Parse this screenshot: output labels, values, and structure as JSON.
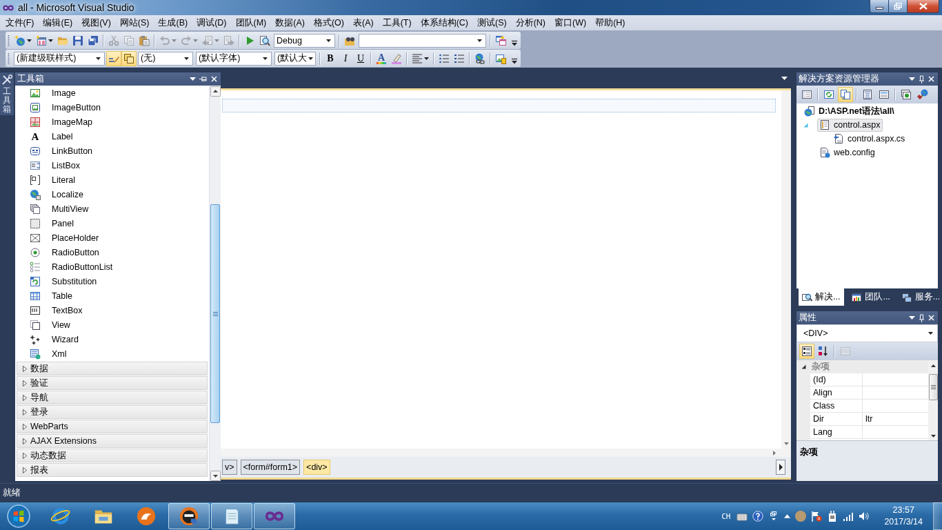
{
  "window": {
    "title": "all - Microsoft Visual Studio"
  },
  "menu": [
    "文件(F)",
    "编辑(E)",
    "视图(V)",
    "网站(S)",
    "生成(B)",
    "调试(D)",
    "团队(M)",
    "数据(A)",
    "格式(O)",
    "表(A)",
    "工具(T)",
    "体系结构(C)",
    "测试(S)",
    "分析(N)",
    "窗口(W)",
    "帮助(H)"
  ],
  "standard_toolbar": [
    {
      "kind": "split",
      "disabled": false
    },
    {
      "kind": "split",
      "disabled": false
    },
    {
      "kind": "button",
      "disabled": false
    },
    {
      "kind": "button",
      "disabled": false
    },
    {
      "kind": "button",
      "disabled": false
    },
    {
      "kind": "separator"
    },
    {
      "kind": "button",
      "disabled": true
    },
    {
      "kind": "button",
      "disabled": true
    },
    {
      "kind": "button",
      "disabled": false
    },
    {
      "kind": "separator"
    },
    {
      "kind": "split",
      "disabled": true
    },
    {
      "kind": "split",
      "disabled": true
    },
    {
      "kind": "split",
      "disabled": true
    },
    {
      "kind": "button",
      "disabled": true
    },
    {
      "kind": "separator"
    },
    {
      "kind": "button",
      "disabled": false
    },
    {
      "kind": "button",
      "disabled": false
    },
    {
      "kind": "combo",
      "value": "Debug"
    },
    {
      "kind": "separator"
    },
    {
      "kind": "button",
      "disabled": false
    },
    {
      "kind": "combo"
    },
    {
      "kind": "separator"
    },
    {
      "kind": "button",
      "disabled": false
    },
    {
      "kind": "overflow"
    }
  ],
  "formatting_toolbar": [
    {
      "kind": "combo",
      "value": "(新建级联样式)"
    },
    {
      "kind": "button",
      "pressed": true
    },
    {
      "kind": "button",
      "pressed": true
    },
    {
      "kind": "combo",
      "value": "(无)"
    },
    {
      "kind": "combo",
      "value": "(默认字体)"
    },
    {
      "kind": "combo",
      "value": "(默认大"
    },
    {
      "kind": "separator"
    },
    {
      "kind": "glyph",
      "text": "B",
      "pressed": false
    },
    {
      "kind": "glyph",
      "text": "I",
      "pressed": false
    },
    {
      "kind": "glyph",
      "text": "U",
      "pressed": false
    },
    {
      "kind": "separator"
    },
    {
      "kind": "font-color",
      "text": "A",
      "pressed": false
    },
    {
      "kind": "button",
      "pressed": false
    },
    {
      "kind": "separator"
    },
    {
      "kind": "split",
      "pressed": false
    },
    {
      "kind": "separator"
    },
    {
      "kind": "button",
      "pressed": false
    },
    {
      "kind": "button",
      "pressed": false
    },
    {
      "kind": "separator"
    },
    {
      "kind": "button",
      "pressed": false
    },
    {
      "kind": "separator"
    },
    {
      "kind": "button",
      "pressed": false
    },
    {
      "kind": "overflow"
    }
  ],
  "toolbox": {
    "side_tab": "工具箱",
    "title": "工具箱",
    "items": [
      {
        "label": "Image"
      },
      {
        "label": "ImageButton"
      },
      {
        "label": "ImageMap"
      },
      {
        "label": "Label",
        "glyph": "A"
      },
      {
        "label": "LinkButton"
      },
      {
        "label": "ListBox"
      },
      {
        "label": "Literal"
      },
      {
        "label": "Localize"
      },
      {
        "label": "MultiView"
      },
      {
        "label": "Panel"
      },
      {
        "label": "PlaceHolder"
      },
      {
        "label": "RadioButton"
      },
      {
        "label": "RadioButtonList"
      },
      {
        "label": "Substitution"
      },
      {
        "label": "Table"
      },
      {
        "label": "TextBox"
      },
      {
        "label": "View"
      },
      {
        "label": "Wizard"
      },
      {
        "label": "Xml"
      }
    ],
    "categories": [
      {
        "label": "数据",
        "expanded": false
      },
      {
        "label": "验证",
        "expanded": false
      },
      {
        "label": "导航",
        "expanded": false
      },
      {
        "label": "登录",
        "expanded": false
      },
      {
        "label": "WebParts",
        "expanded": false
      },
      {
        "label": "AJAX Extensions",
        "expanded": false
      },
      {
        "label": "动态数据",
        "expanded": false
      },
      {
        "label": "报表",
        "expanded": false
      }
    ]
  },
  "editor": {
    "tags": [
      {
        "label": "v>",
        "selected": false
      },
      {
        "label": "<form#form1>",
        "selected": false
      },
      {
        "label": "<div>",
        "selected": true
      }
    ]
  },
  "solution_explorer": {
    "title": "解决方案资源管理器",
    "toolbar": [
      {
        "kind": "button",
        "pressed": false
      },
      {
        "kind": "separator"
      },
      {
        "kind": "button",
        "pressed": false
      },
      {
        "kind": "button",
        "pressed": true
      },
      {
        "kind": "separator"
      },
      {
        "kind": "button",
        "pressed": false
      },
      {
        "kind": "button",
        "pressed": false
      },
      {
        "kind": "separator"
      },
      {
        "kind": "button",
        "pressed": false
      },
      {
        "kind": "button",
        "pressed": false
      }
    ],
    "tree": [
      {
        "label": "D:\\ASP.net语法\\all\\",
        "kind": "site",
        "selected": false,
        "children": [
          {
            "label": "control.aspx",
            "kind": "page",
            "selected": true,
            "expanded": true,
            "children": [
              {
                "label": "control.aspx.cs",
                "kind": "code",
                "selected": false,
                "expanded": false
              }
            ]
          },
          {
            "label": "web.config",
            "kind": "config",
            "selected": false,
            "expanded": false
          }
        ]
      }
    ],
    "tabs": [
      {
        "label": "解决...",
        "selected": true
      },
      {
        "label": "团队...",
        "selected": false
      },
      {
        "label": "服务...",
        "selected": false
      }
    ]
  },
  "properties": {
    "title": "属性",
    "object": "<DIV>",
    "toolbar": [
      {
        "kind": "button",
        "pressed": true,
        "disabled": false
      },
      {
        "kind": "button",
        "pressed": false,
        "disabled": false
      },
      {
        "kind": "separator"
      },
      {
        "kind": "button",
        "pressed": false,
        "disabled": true
      }
    ],
    "category": {
      "label": "杂项",
      "expanded": true
    },
    "rows": [
      {
        "name": "(Id)"
      },
      {
        "name": "Align"
      },
      {
        "name": "Class"
      },
      {
        "name": "Dir",
        "value": "ltr"
      },
      {
        "name": "Lang"
      }
    ],
    "description": "杂项"
  },
  "status_bar": {
    "text": "就绪"
  },
  "taskbar": {
    "apps": [
      {
        "running": false
      },
      {
        "running": false
      },
      {
        "running": false
      },
      {
        "running": true
      },
      {
        "running": true
      },
      {
        "running": true
      }
    ],
    "language": "CH",
    "time": "23:57",
    "date": "2017/3/14"
  }
}
